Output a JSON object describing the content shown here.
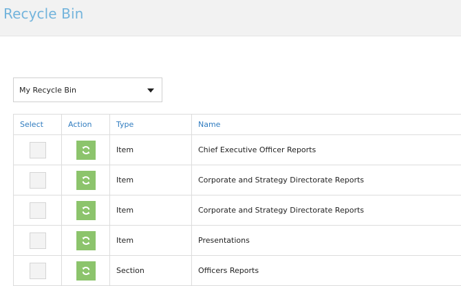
{
  "header": {
    "title": "Recycle Bin"
  },
  "bin_selector": {
    "selected": "My Recycle Bin"
  },
  "table": {
    "columns": [
      "Select",
      "Action",
      "Type",
      "Name"
    ],
    "rows": [
      {
        "type": "Item",
        "name": "Chief Executive Officer Reports",
        "selected": false
      },
      {
        "type": "Item",
        "name": "Corporate and Strategy Directorate Reports",
        "selected": false
      },
      {
        "type": "Item",
        "name": "Corporate and Strategy Directorate Reports",
        "selected": false
      },
      {
        "type": "Item",
        "name": "Presentations",
        "selected": false
      },
      {
        "type": "Section",
        "name": "Officers Reports",
        "selected": false
      }
    ]
  },
  "icons": {
    "restore": "refresh-icon",
    "dropdown": "caret-down-icon"
  },
  "colors": {
    "title": "#73b4dc",
    "header_bg": "#f2f2f2",
    "column_header_text": "#2f7bbf",
    "restore_button": "#8cc46c"
  }
}
